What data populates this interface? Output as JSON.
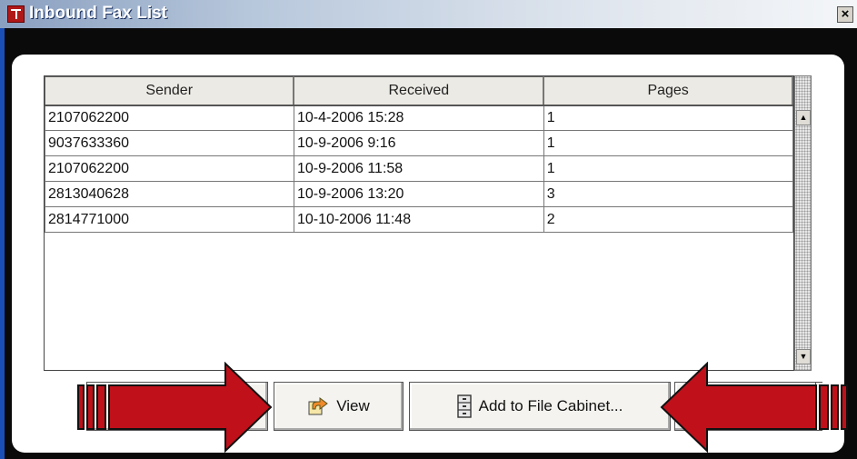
{
  "window": {
    "title": "Inbound Fax List",
    "close_glyph": "×"
  },
  "table": {
    "columns": [
      "Sender",
      "Received",
      "Pages"
    ],
    "rows": [
      [
        "2107062200",
        "10-4-2006 15:28",
        "1"
      ],
      [
        "9037633360",
        "10-9-2006 9:16",
        "1"
      ],
      [
        "2107062200",
        "10-9-2006 11:58",
        "1"
      ],
      [
        "2813040628",
        "10-9-2006 13:20",
        "3"
      ],
      [
        "2814771000",
        "10-10-2006 11:48",
        "2"
      ]
    ]
  },
  "buttons": {
    "view": "View",
    "add_to_file_cabinet": "Add to File Cabinet..."
  },
  "scrollbar": {
    "up_glyph": "▲",
    "down_glyph": "▼"
  },
  "icons": {
    "app": "fax-app-icon",
    "view": "open-arrow-icon",
    "add": "file-cabinet-icon",
    "close": "close-icon"
  },
  "colors": {
    "arrow_red": "#c0101a",
    "titlebar_start": "#8aa0c0",
    "panel": "#ffffff",
    "background": "#0a0a0a"
  }
}
